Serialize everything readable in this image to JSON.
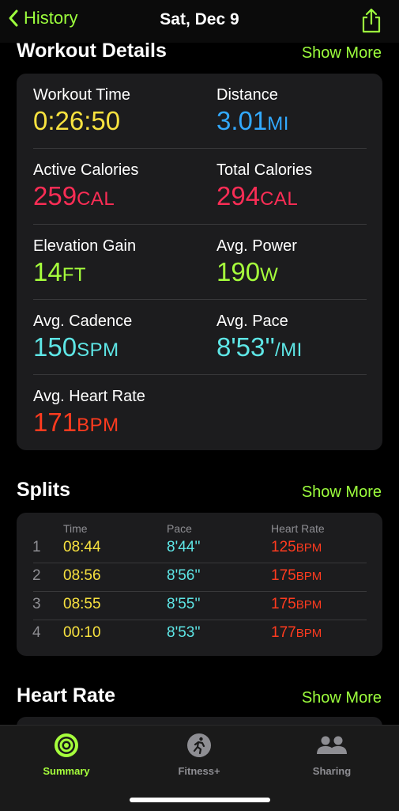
{
  "nav": {
    "back_label": "History",
    "title": "Sat, Dec 9"
  },
  "workout_details": {
    "title": "Workout Details",
    "show_more": "Show More",
    "metrics": [
      {
        "label": "Workout Time",
        "value": "0:26:50",
        "unit": "",
        "color": "#f8e23f"
      },
      {
        "label": "Distance",
        "value": "3.01",
        "unit": "MI",
        "color": "#32a9ff"
      },
      {
        "label": "Active Calories",
        "value": "259",
        "unit": "CAL",
        "color": "#fa2d55"
      },
      {
        "label": "Total Calories",
        "value": "294",
        "unit": "CAL",
        "color": "#fa2d55"
      },
      {
        "label": "Elevation Gain",
        "value": "14",
        "unit": "FT",
        "color": "#a6ff3c"
      },
      {
        "label": "Avg. Power",
        "value": "190",
        "unit": "W",
        "color": "#a6ff3c"
      },
      {
        "label": "Avg. Cadence",
        "value": "150",
        "unit": "SPM",
        "color": "#5ee6e6"
      },
      {
        "label": "Avg. Pace",
        "value": "8'53''",
        "unit": "/MI",
        "color": "#5ee6e6"
      },
      {
        "label": "Avg. Heart Rate",
        "value": "171",
        "unit": "BPM",
        "color": "#ff3b1f"
      }
    ]
  },
  "splits": {
    "title": "Splits",
    "show_more": "Show More",
    "headers": {
      "time": "Time",
      "pace": "Pace",
      "heart_rate": "Heart Rate"
    },
    "rows": [
      {
        "num": "1",
        "time": "08:44",
        "pace": "8'44''",
        "hr": "125",
        "hr_unit": "BPM"
      },
      {
        "num": "2",
        "time": "08:56",
        "pace": "8'56''",
        "hr": "175",
        "hr_unit": "BPM"
      },
      {
        "num": "3",
        "time": "08:55",
        "pace": "8'55''",
        "hr": "175",
        "hr_unit": "BPM"
      },
      {
        "num": "4",
        "time": "00:10",
        "pace": "8'53''",
        "hr": "177",
        "hr_unit": "BPM"
      }
    ]
  },
  "heart_rate": {
    "title": "Heart Rate",
    "show_more": "Show More"
  },
  "tabs": [
    {
      "label": "Summary",
      "icon": "activity-rings-icon",
      "active": true
    },
    {
      "label": "Fitness+",
      "icon": "running-figure-icon",
      "active": false
    },
    {
      "label": "Sharing",
      "icon": "people-icon",
      "active": false
    }
  ],
  "colors": {
    "accent": "#9dff3d",
    "background": "#000000",
    "card": "#1c1c1e"
  }
}
